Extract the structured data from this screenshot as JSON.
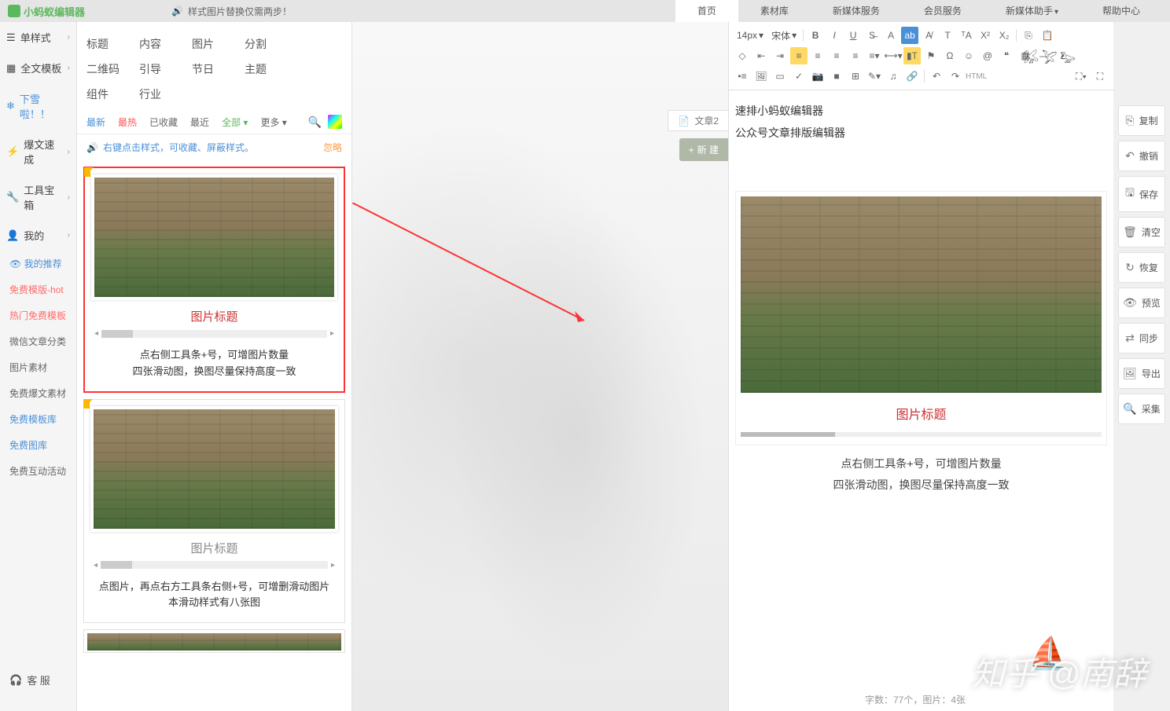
{
  "logo": "小蚂蚁编辑器",
  "announce": "样式图片替换仅需两步！",
  "topnav": [
    "首页",
    "素材库",
    "新媒体服务",
    "会员服务",
    "新媒体助手",
    "帮助中心"
  ],
  "sidebar": {
    "items": [
      {
        "label": "单样式",
        "icon": "☰"
      },
      {
        "label": "全文模板",
        "icon": "▦"
      },
      {
        "label": "下雪啦！！",
        "icon": "❄"
      },
      {
        "label": "爆文速成",
        "icon": "⚡"
      },
      {
        "label": "工具宝箱",
        "icon": "🔧"
      },
      {
        "label": "我的",
        "icon": "👤"
      }
    ],
    "subs": [
      {
        "label": "我的推荐",
        "cls": "blue"
      },
      {
        "label": "免费模版-hot",
        "cls": "hot"
      },
      {
        "label": "热门免费模板",
        "cls": "hot"
      },
      {
        "label": "微信文章分类",
        "cls": ""
      },
      {
        "label": "图片素材",
        "cls": ""
      },
      {
        "label": "免费爆文素材",
        "cls": ""
      },
      {
        "label": "免费模板库",
        "cls": "blue"
      },
      {
        "label": "免费图库",
        "cls": "blue"
      },
      {
        "label": "免费互动活动",
        "cls": ""
      }
    ],
    "customer": "客 服"
  },
  "categories": [
    "标题",
    "内容",
    "图片",
    "分割",
    "二维码",
    "引导",
    "节日",
    "主题",
    "组件",
    "行业"
  ],
  "filters": {
    "new": "最新",
    "hot": "最热",
    "fav": "已收藏",
    "recent": "最近",
    "all": "全部",
    "more": "更多"
  },
  "hint": "右键点击样式，可收藏、屏蔽样式。",
  "ignore": "忽略",
  "card1": {
    "title": "图片标题",
    "desc1": "点右侧工具条+号，可增图片数量",
    "desc2": "四张滑动图，换图尽量保持高度一致"
  },
  "card2": {
    "title": "图片标题",
    "desc1": "点图片，再点右方工具条右侧+号，可增删滑动图片",
    "desc2": "本滑动样式有八张图"
  },
  "doctab": "文章2",
  "newbtn": "新 建",
  "toolbar": {
    "fontsize": "14px",
    "fontfamily": "宋体",
    "html": "HTML"
  },
  "editor": {
    "line1": "速排小蚂蚁编辑器",
    "line2": "公众号文章排版编辑器",
    "preview_title": "图片标题",
    "preview_desc1": "点右侧工具条+号，可增图片数量",
    "preview_desc2": "四张滑动图，换图尽量保持高度一致"
  },
  "actions": [
    "复制",
    "撤销",
    "保存",
    "清空",
    "恢复",
    "预览",
    "同步",
    "导出",
    "采集"
  ],
  "action_icons": [
    "⎘",
    "↶",
    "🖫",
    "🗑",
    "↻",
    "👁",
    "⇄",
    "🖼",
    "🔍"
  ],
  "status": "字数：77个，图片：4张",
  "watermark": "知乎 @南辞"
}
